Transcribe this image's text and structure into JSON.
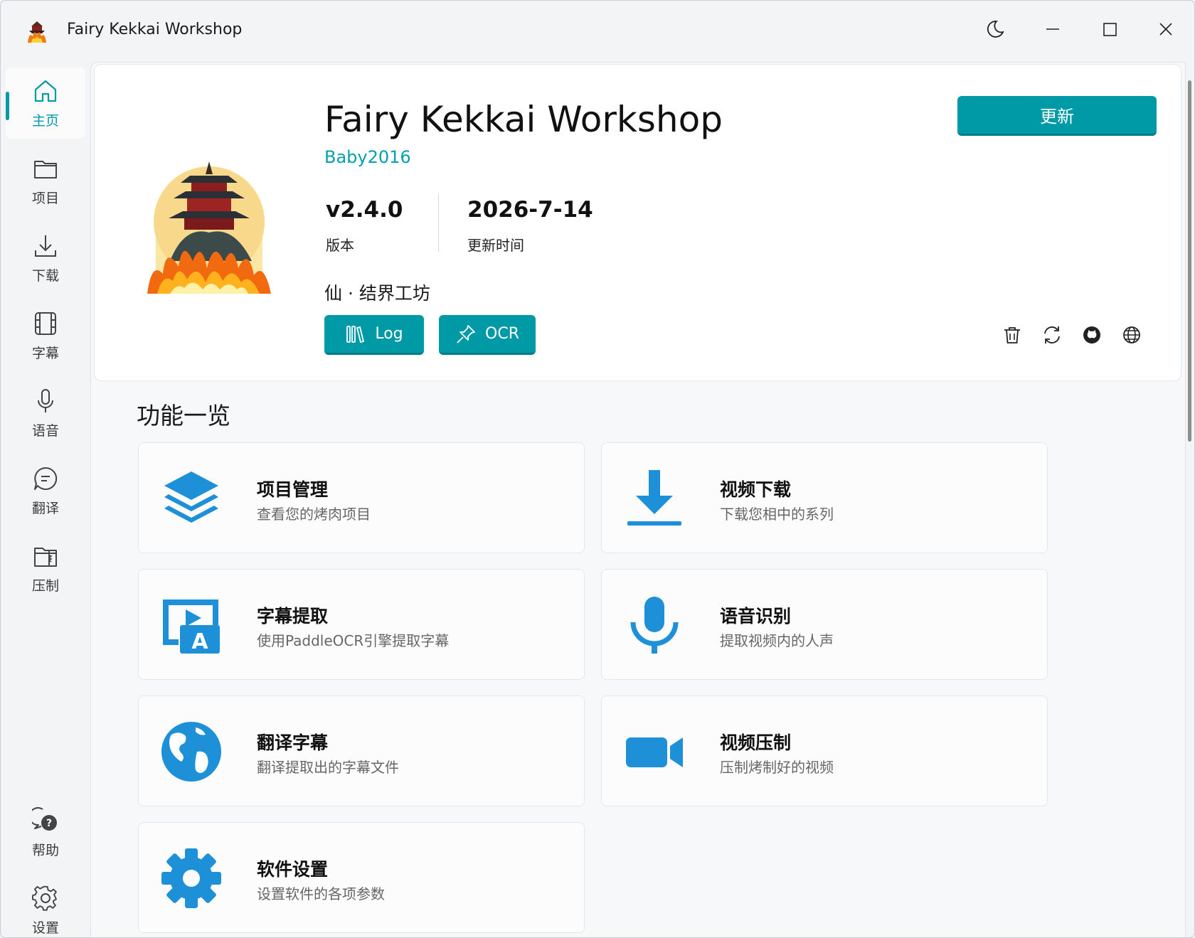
{
  "window": {
    "title": "Fairy Kekkai Workshop"
  },
  "sidebar": {
    "items": [
      {
        "label": "主页",
        "icon": "home-icon",
        "active": true
      },
      {
        "label": "项目",
        "icon": "folder-icon"
      },
      {
        "label": "下载",
        "icon": "download-icon"
      },
      {
        "label": "字幕",
        "icon": "film-icon"
      },
      {
        "label": "语音",
        "icon": "microphone-icon"
      },
      {
        "label": "翻译",
        "icon": "chat-icon"
      },
      {
        "label": "压制",
        "icon": "zip-folder-icon"
      }
    ],
    "bottom": [
      {
        "label": "帮助",
        "icon": "help-chat-icon"
      },
      {
        "label": "设置",
        "icon": "gear-icon"
      }
    ]
  },
  "header": {
    "name": "Fairy Kekkai Workshop",
    "author": "Baby2016",
    "version": "v2.4.0",
    "version_label": "版本",
    "date": "2026-7-14",
    "date_label": "更新时间",
    "subtitle": "仙 · 结界工坊",
    "update_label": "更新",
    "log_label": "Log",
    "ocr_label": "OCR"
  },
  "section": {
    "title": "功能一览"
  },
  "features": [
    {
      "title": "项目管理",
      "desc": "查看您的烤肉项目",
      "icon": "layers-icon"
    },
    {
      "title": "视频下载",
      "desc": "下载您相中的系列",
      "icon": "download-icon"
    },
    {
      "title": "字幕提取",
      "desc": "使用PaddleOCR引擎提取字幕",
      "icon": "subtitle-icon"
    },
    {
      "title": "语音识别",
      "desc": "提取视频内的人声",
      "icon": "microphone-icon"
    },
    {
      "title": "翻译字幕",
      "desc": "翻译提取出的字幕文件",
      "icon": "globe-icon"
    },
    {
      "title": "视频压制",
      "desc": "压制烤制好的视频",
      "icon": "video-camera-icon"
    },
    {
      "title": "软件设置",
      "desc": "设置软件的各项参数",
      "icon": "gear-icon"
    }
  ],
  "colors": {
    "accent": "#009aa6",
    "feature_icon": "#1e90d8"
  }
}
